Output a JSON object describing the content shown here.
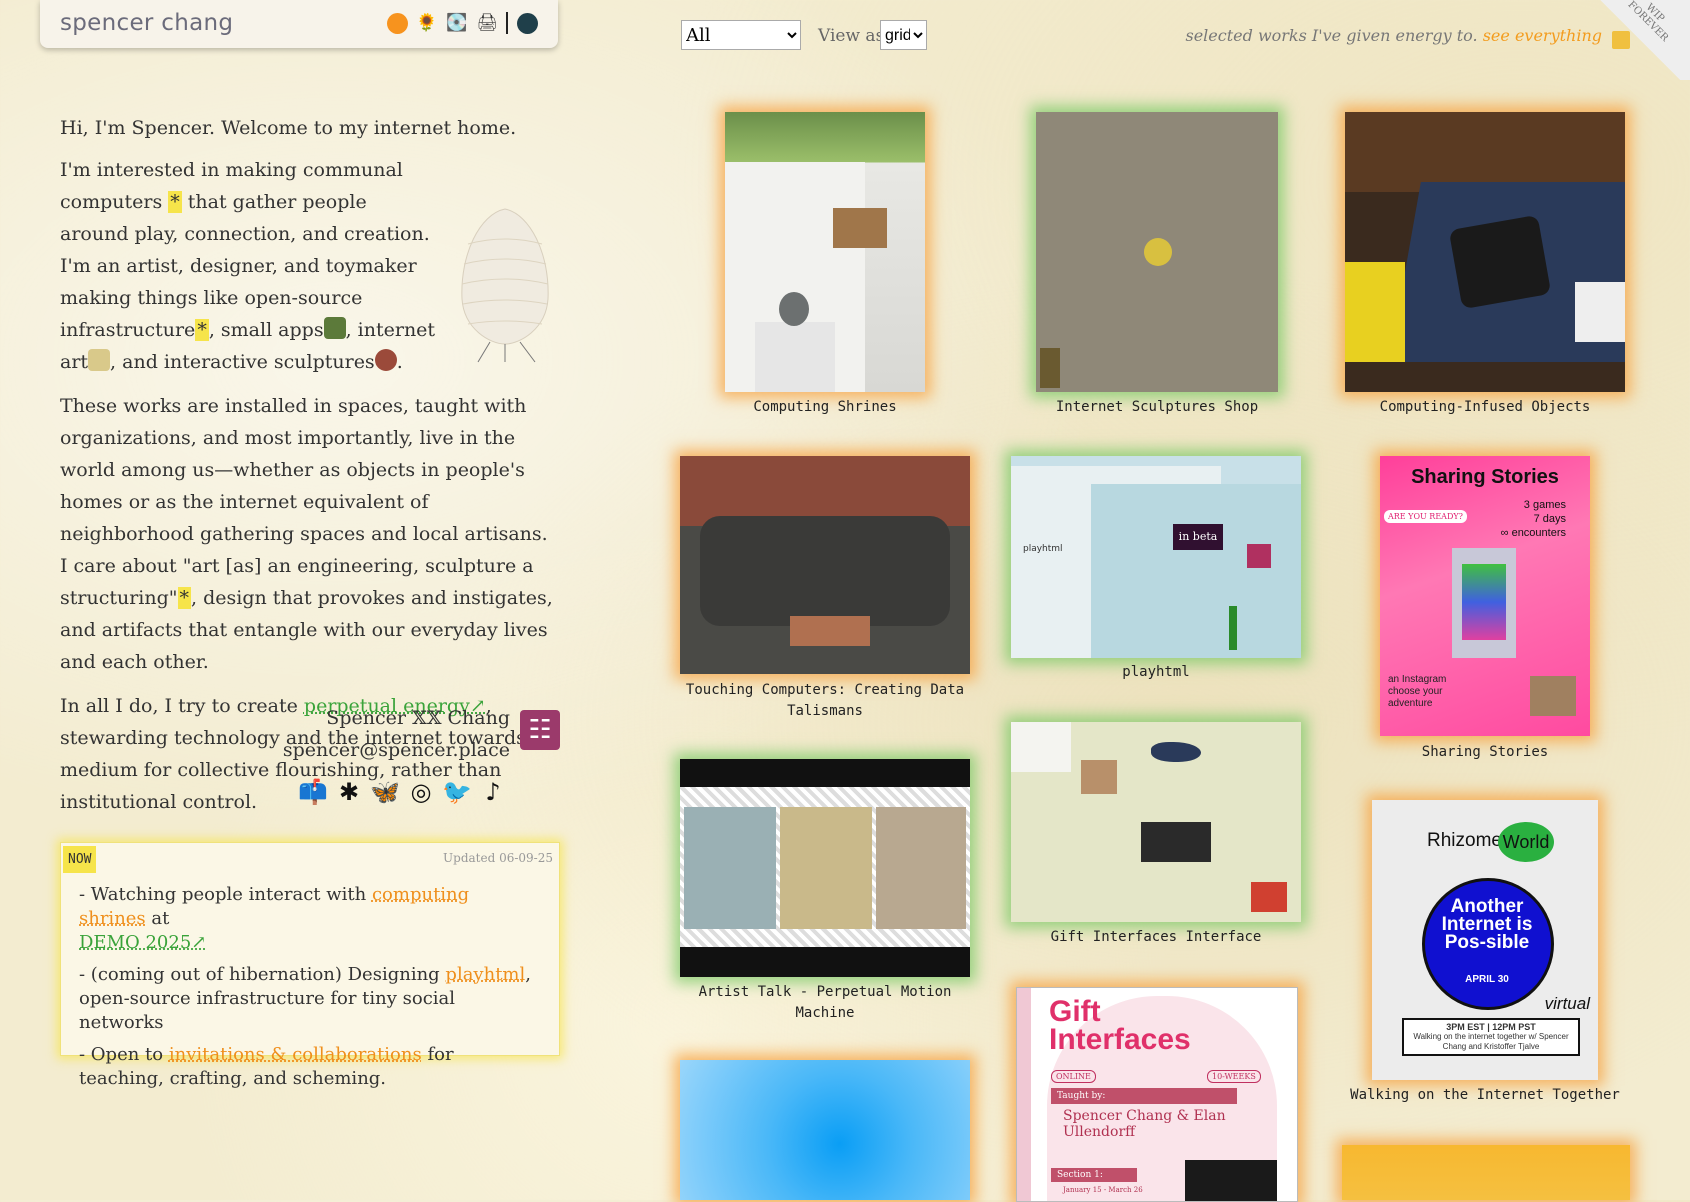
{
  "header": {
    "site_title": "spencer chang",
    "icons": [
      "orange-circle-icon",
      "sunflower-icon",
      "cd-icon",
      "printer-icon",
      "dark-circle-icon"
    ]
  },
  "intro": {
    "p1": "Hi, I'm Spencer. Welcome to my internet home.",
    "p2_a": "I'm interested in making communal computers ",
    "p2_star1": "*",
    "p2_b": " that gather people around play, connection, and creation. I'm an artist, designer, and toymaker making things like open-source infrastructure",
    "p2_star2": "*",
    "p2_c": ", small apps",
    "p2_d": ", internet art",
    "p2_e": ", and interactive sculptures",
    "p2_f": ".",
    "p3_a": "These works are installed in spaces, taught with organizations, and most importantly, live in the world among us—whether as objects in people's homes or as the internet equivalent of neighborhood gathering spaces and local artisans. I care about \"art [as] an engineering, sculpture a structuring\"",
    "p3_star": "*",
    "p3_b": ", design that provokes and instigates, and artifacts that entangle with our everyday lives and each other.",
    "p4_a": "In all I do, I try to create ",
    "p4_link": "perpetual energy↗",
    "p4_b": ", stewarding technology and the internet towards a medium for collective flourishing, rather than institutional control."
  },
  "signature": {
    "name": "Spencer 𝕏𝕏 Chang",
    "email": "spencer@spencer.place",
    "social_icons": [
      "mailbox-icon",
      "sparkle-icon",
      "butterfly-icon",
      "instagram-icon",
      "twitter-icon",
      "tiktok-icon"
    ]
  },
  "now": {
    "tag": "NOW",
    "updated": "Updated 06-09-25",
    "item1_a": "- Watching people interact with ",
    "item1_link1": "computing shrines",
    "item1_b": " at ",
    "item1_link2": "DEMO 2025↗",
    "item2_a": "- (coming out of hibernation) Designing ",
    "item2_link": "playhtml",
    "item2_b": ", open-source infrastructure for tiny social networks",
    "item3_a": "- Open to ",
    "item3_link": "invitations & collaborations",
    "item3_b": " for teaching, crafting, and scheming."
  },
  "controls": {
    "filter_value": "All",
    "view_label": "View as",
    "view_value": "grid",
    "tagline": "selected works I've given energy to.",
    "see_everything": "see everything",
    "corner": "WIP FOREVER"
  },
  "works": [
    {
      "title": "Computing Shrines",
      "glow": "orange"
    },
    {
      "title": "Internet Sculptures Shop",
      "glow": "green"
    },
    {
      "title": "Computing-Infused Objects",
      "glow": "orange"
    },
    {
      "title": "Touching Computers: Creating Data Talismans",
      "glow": "orange"
    },
    {
      "title": "playhtml",
      "glow": "green"
    },
    {
      "title": "Sharing Stories",
      "glow": "orange"
    },
    {
      "title": "Artist Talk - Perpetual Motion Machine",
      "glow": "green"
    },
    {
      "title": "Gift Interfaces Interface",
      "glow": "green"
    },
    {
      "title": "Walking on the Internet Together",
      "glow": "orange"
    },
    {
      "title": "",
      "glow": "orange"
    },
    {
      "title": "",
      "glow": "orange"
    },
    {
      "title": "",
      "glow": "orange"
    }
  ],
  "thumb_text": {
    "sharing_stories_title": "Sharing Stories",
    "sharing_stories_stats": "3 games\n7 days\n∞ encounters",
    "sharing_stories_sub": "an Instagram choose your adventure",
    "sharing_stories_badge": "ARE YOU READY?",
    "rhizome": "Rhizome",
    "world": "World",
    "another_internet": "Another Internet is Pos-sible",
    "april": "APRIL 30",
    "virtual": "virtual",
    "rhizome_time": "3PM EST | 12PM PST",
    "rhizome_desc": "Walking on the internet together w/ Spencer Chang and Kristoffer Tjalve",
    "gift_title": "Gift Interfaces",
    "gift_online": "ONLINE",
    "gift_weeks": "10-WEEKS",
    "gift_taught": "Taught by:",
    "gift_names": "Spencer Chang & Elan Ullendorff",
    "gift_section": "Section 1:",
    "gift_dates": "January 15 - March 26",
    "playhtml_label": "playhtml",
    "in_beta": "in beta"
  },
  "colors": {
    "accent_orange": "#ef8f1c",
    "accent_green": "#3aa33a",
    "highlight_yellow": "#f6e44a"
  }
}
